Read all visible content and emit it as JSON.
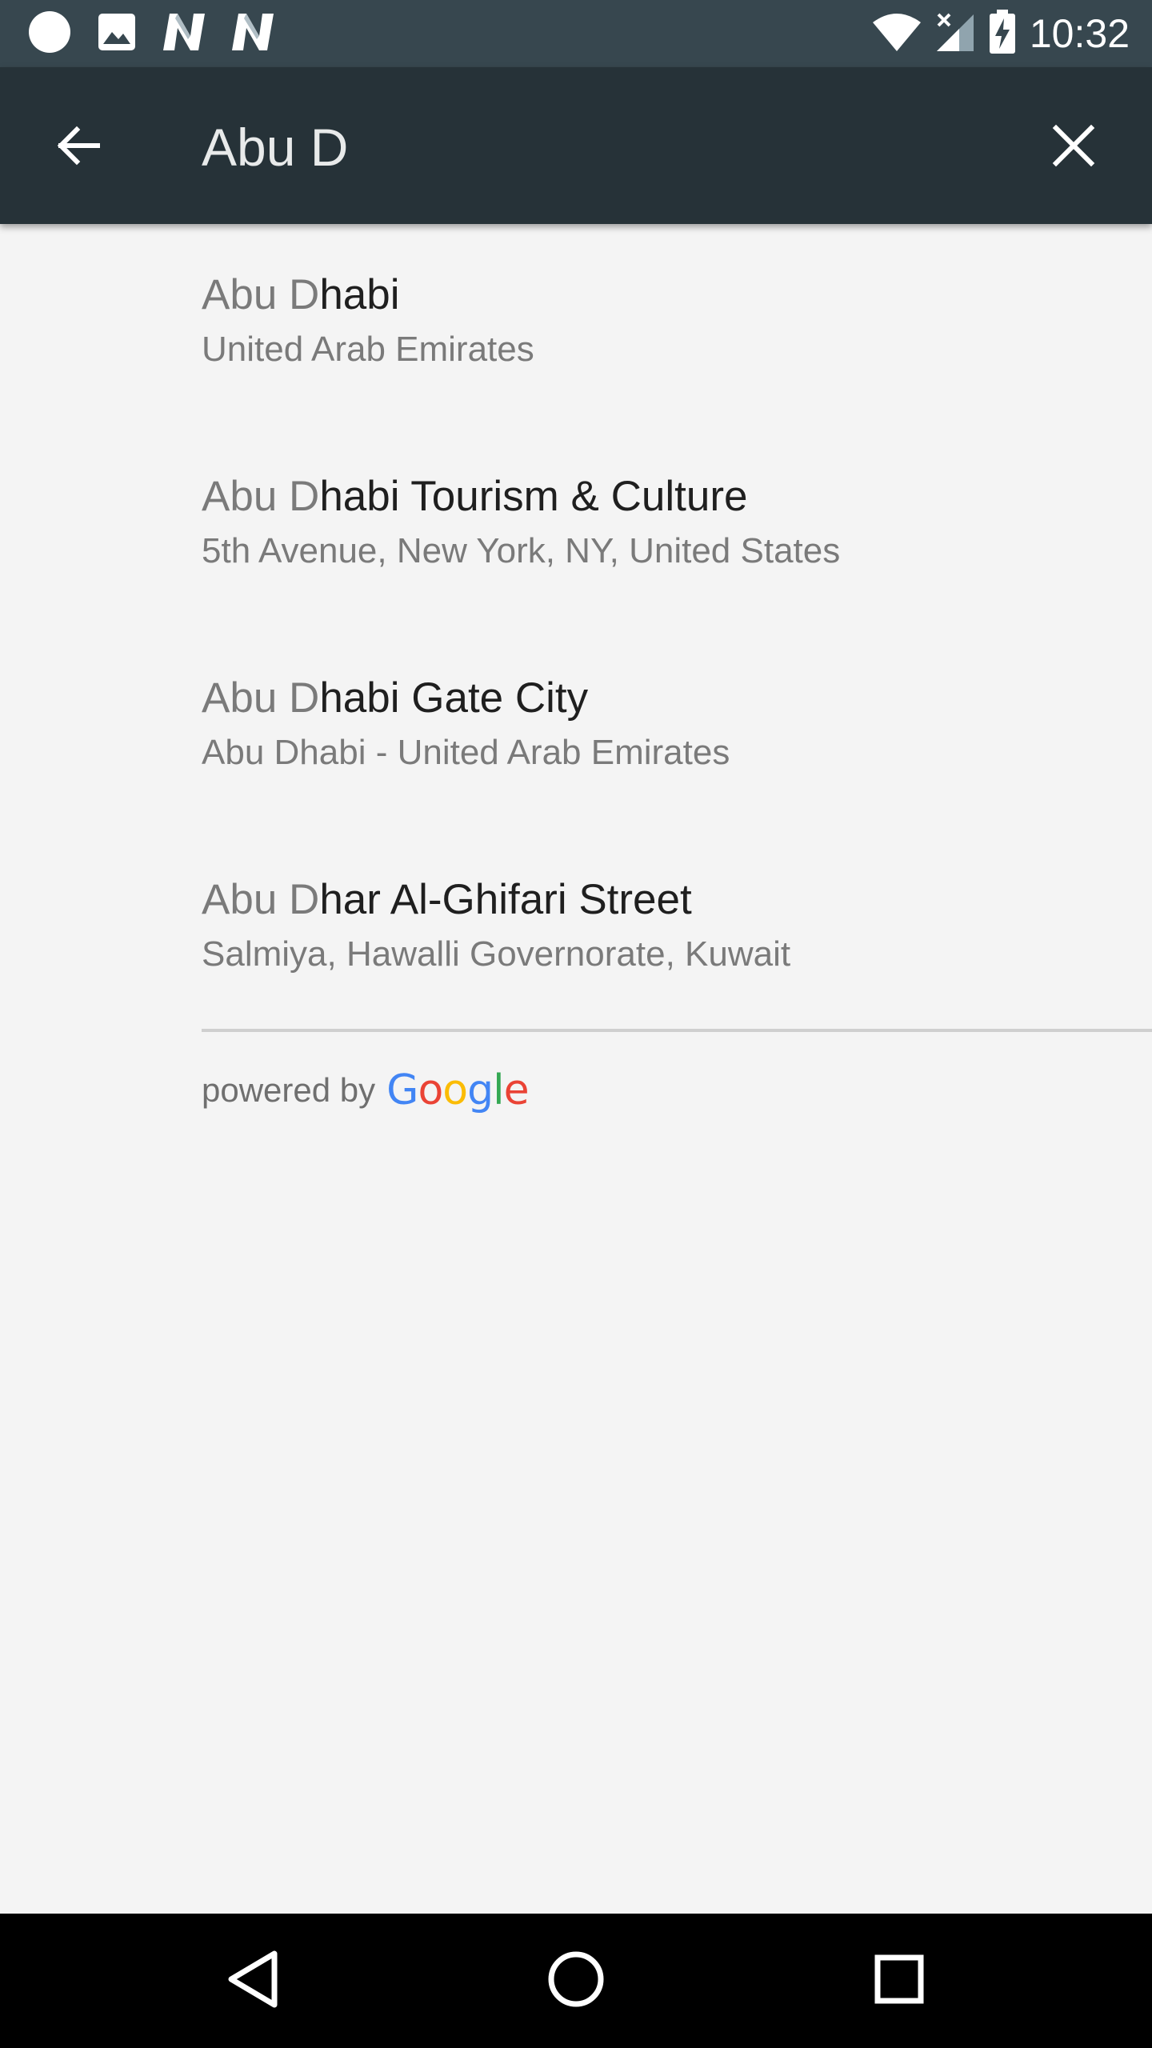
{
  "status_bar": {
    "time": "10:32",
    "left_icons": [
      "record-circle-icon",
      "image-notification-icon",
      "n-notification-icon",
      "n-notification-icon"
    ],
    "right_icons": [
      "wifi-icon",
      "cellular-no-signal-icon",
      "battery-charging-icon"
    ]
  },
  "toolbar": {
    "search_value": "Abu D",
    "back_icon": "arrow-left-icon",
    "clear_icon": "close-icon"
  },
  "results": [
    {
      "match": "Abu D",
      "rest": "habi",
      "subtitle": "United Arab Emirates"
    },
    {
      "match": "Abu D",
      "rest": "habi Tourism & Culture",
      "subtitle": "5th Avenue, New York, NY, United States"
    },
    {
      "match": "Abu D",
      "rest": "habi Gate City",
      "subtitle": "Abu Dhabi - United Arab Emirates"
    },
    {
      "match": "Abu D",
      "rest": "har Al-Ghifari Street",
      "subtitle": "Salmiya, Hawalli Governorate, Kuwait"
    }
  ],
  "attribution": {
    "text": "powered by",
    "logo_letters": [
      "G",
      "o",
      "o",
      "g",
      "l",
      "e"
    ],
    "logo_colors": [
      "#4285f4",
      "#ea4335",
      "#fbbc05",
      "#4285f4",
      "#34a853",
      "#ea4335"
    ]
  },
  "nav_bar": {
    "icons": [
      "back-triangle-icon",
      "home-circle-icon",
      "recents-square-icon"
    ]
  },
  "colors": {
    "status_bar_bg": "#37474f",
    "toolbar_bg": "#263238",
    "page_bg": "#f4f4f4"
  }
}
